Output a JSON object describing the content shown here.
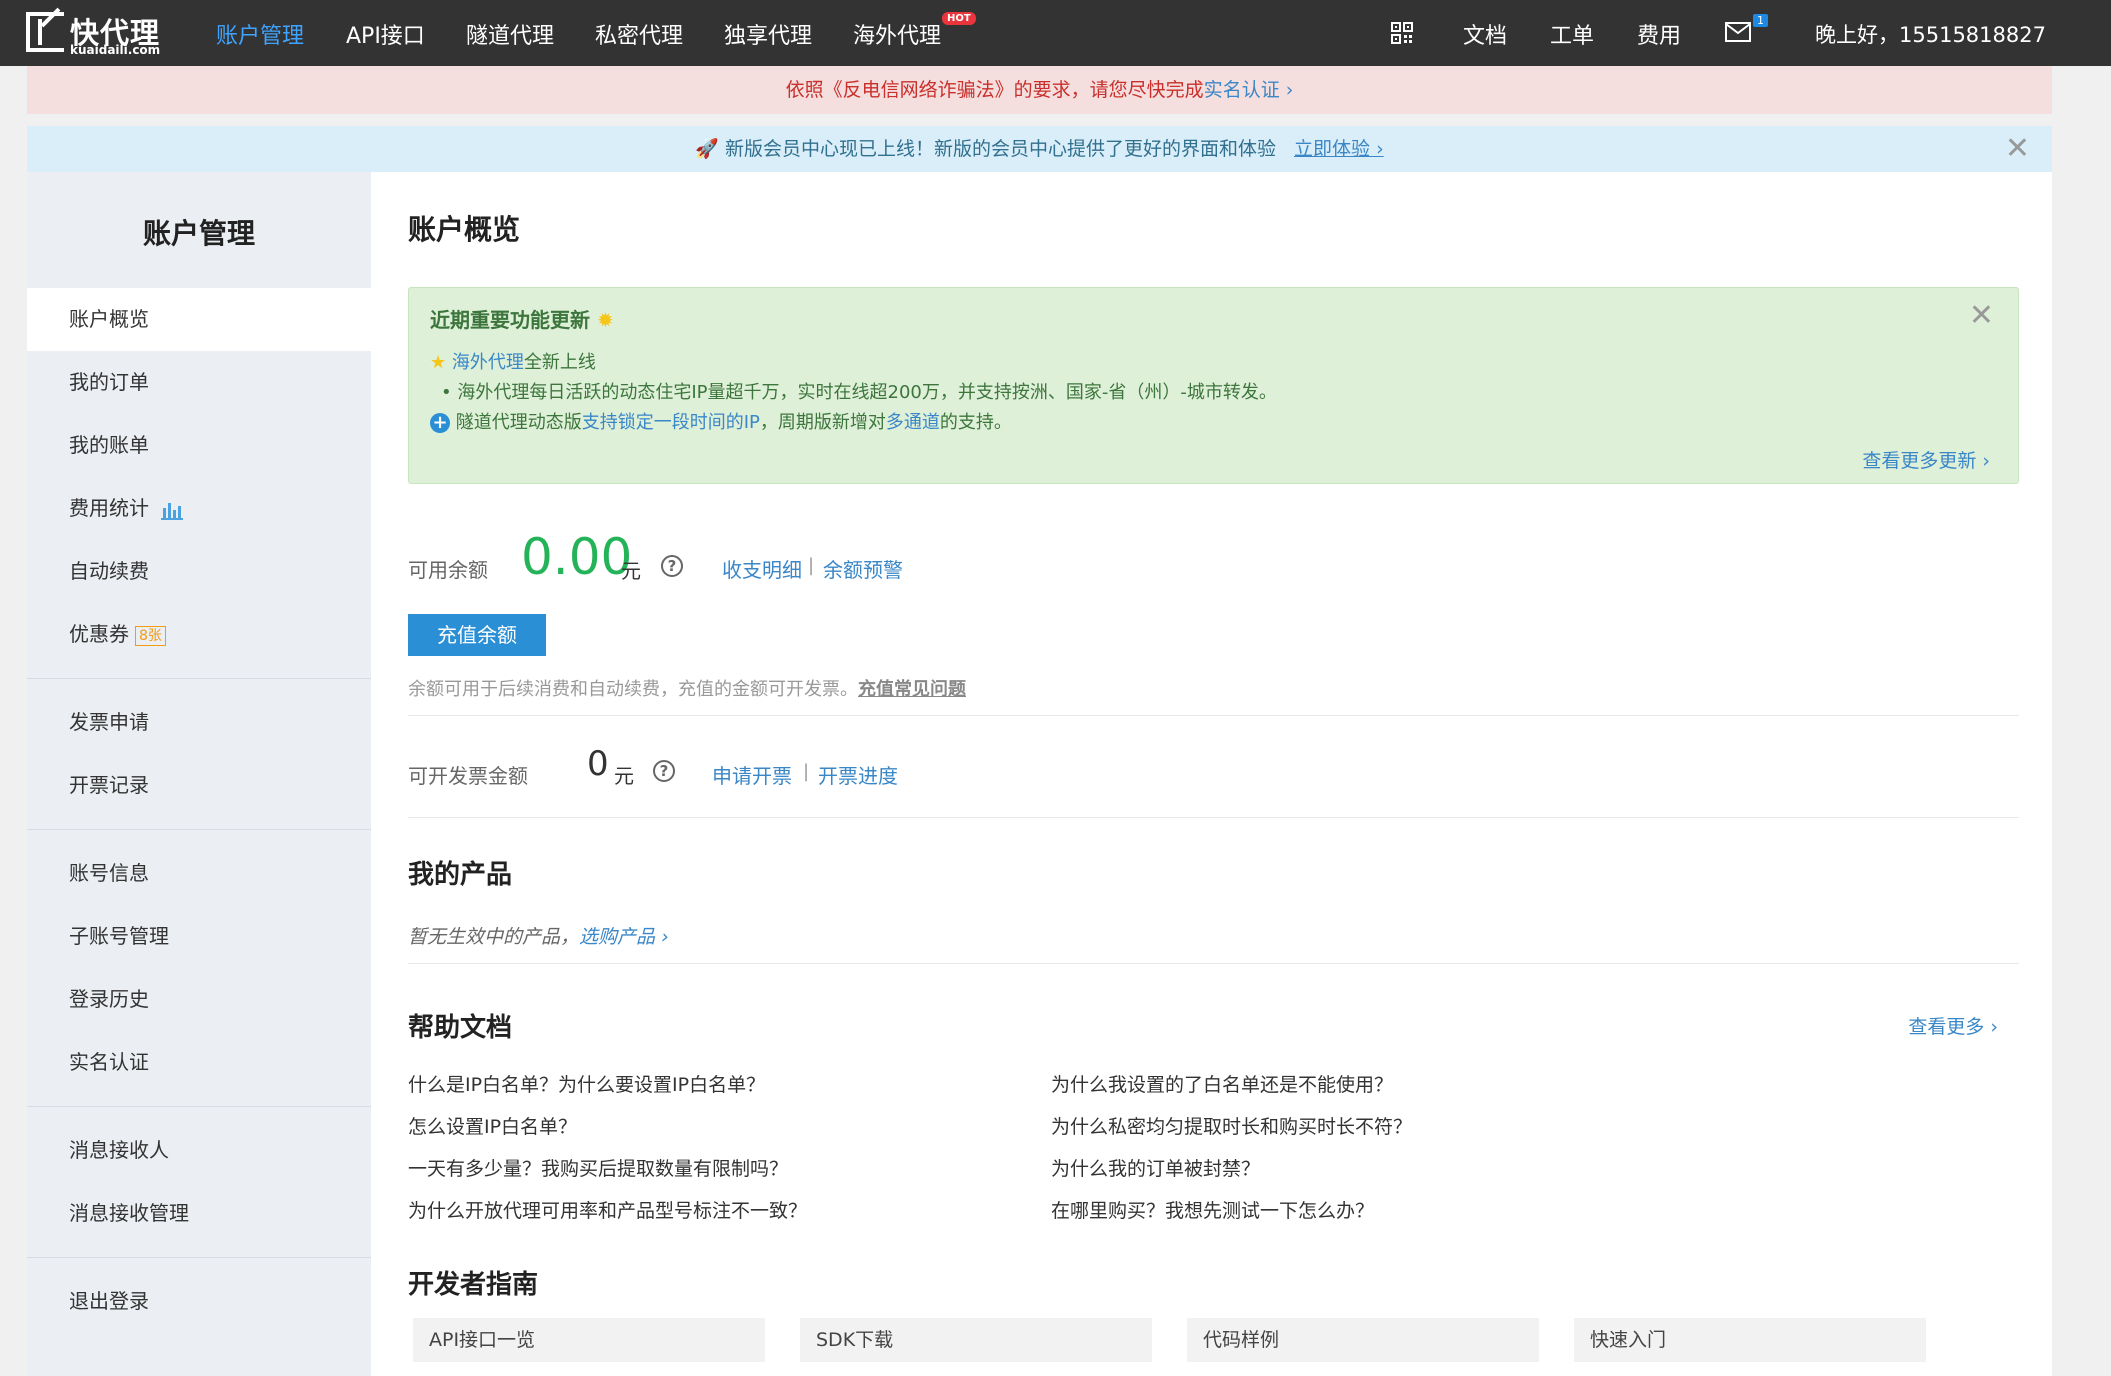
{
  "nav": {
    "logo_name": "快代理",
    "logo_domain": "kuaidaili.com",
    "items": [
      "账户管理",
      "API接口",
      "隧道代理",
      "私密代理",
      "独享代理",
      "海外代理"
    ],
    "hot": "HOT",
    "right": [
      "文档",
      "工单",
      "费用"
    ],
    "mail_count": "1",
    "greeting": "晚上好，15515818827"
  },
  "warn_banner": {
    "text": "依照《反电信网络诈骗法》的要求，请您尽快完成",
    "link": "实名认证 ›"
  },
  "info_banner": {
    "text": "🚀 新版会员中心现已上线！新版的会员中心提供了更好的界面和体验",
    "link": "立即体验 ›",
    "close": "✕"
  },
  "sidebar": {
    "title": "账户管理",
    "items": [
      "账户概览",
      "我的订单",
      "我的账单",
      "费用统计",
      "自动续费",
      "优惠券",
      "发票申请",
      "开票记录",
      "账号信息",
      "子账号管理",
      "登录历史",
      "实名认证",
      "消息接收人",
      "消息接收管理",
      "退出登录"
    ],
    "coupon_badge": "8张"
  },
  "main": {
    "title": "账户概览",
    "updates": {
      "title": "近期重要功能更新",
      "line1_link": "海外代理",
      "line1_text": "全新上线",
      "line2": "海外代理每日活跃的动态住宅IP量超千万，实时在线超200万，并支持按洲、国家-省（州）-城市转发。",
      "line3_a": "隧道代理动态版",
      "line3_b": "支持锁定一段时间的IP",
      "line3_c": "，周期版新增对",
      "line3_d": "多通道",
      "line3_e": "的支持。",
      "more": "查看更多更新 ›"
    },
    "balance": {
      "label": "可用余额",
      "amount": "0.00",
      "unit": "元",
      "detail_link": "收支明细",
      "alert_link": "余额预警",
      "button": "充值余额",
      "note": "余额可用于后续消费和自动续费，充值的金额可开发票。",
      "faq": "充值常见问题"
    },
    "invoice": {
      "label": "可开发票金额",
      "amount": "0",
      "unit": "元",
      "apply_link": "申请开票",
      "progress_link": "开票进度"
    },
    "products": {
      "title": "我的产品",
      "empty": "暂无生效中的产品，",
      "buy": "选购产品 ›"
    },
    "help": {
      "title": "帮助文档",
      "more": "查看更多 ›",
      "links": [
        "什么是IP白名单？为什么要设置IP白名单？",
        "为什么我设置的了白名单还是不能使用？",
        "怎么设置IP白名单？",
        "为什么私密均匀提取时长和购买时长不符？",
        "一天有多少量？我购买后提取数量有限制吗？",
        "为什么我的订单被封禁？",
        "为什么开放代理可用率和产品型号标注不一致？",
        "在哪里购买？我想先测试一下怎么办？"
      ]
    },
    "dev": {
      "title": "开发者指南",
      "cards": [
        "API接口一览",
        "SDK下载",
        "代码样例",
        "快速入门"
      ]
    }
  }
}
